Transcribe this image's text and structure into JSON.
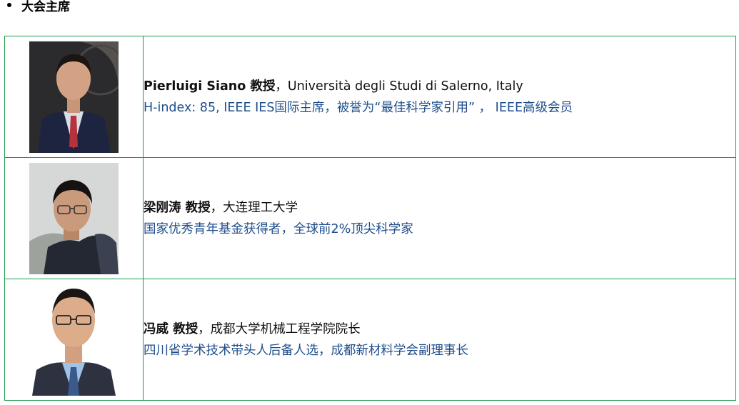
{
  "section": {
    "title": "大会主席"
  },
  "chairs": [
    {
      "name": "Pierluigi Siano 教授",
      "sep": "，",
      "affiliation": "Università degli Studi di Salerno, Italy",
      "honors": "H-index: 85, IEEE IES国际主席，被誉为“最佳科学家引用” ， IEEE高级会员"
    },
    {
      "name": "梁刚涛 教授",
      "sep": "，",
      "affiliation": "大连理工大学",
      "honors": "国家优秀青年基金获得者，全球前2%顶尖科学家"
    },
    {
      "name": "冯威 教授",
      "sep": "，",
      "affiliation": "成都大学机械工程学院院长",
      "honors": "四川省学术技术带头人后备人选，成都新材料学会副理事长"
    }
  ],
  "colors": {
    "border": "#1f9a4f",
    "honors_text": "#1f4e8c"
  }
}
